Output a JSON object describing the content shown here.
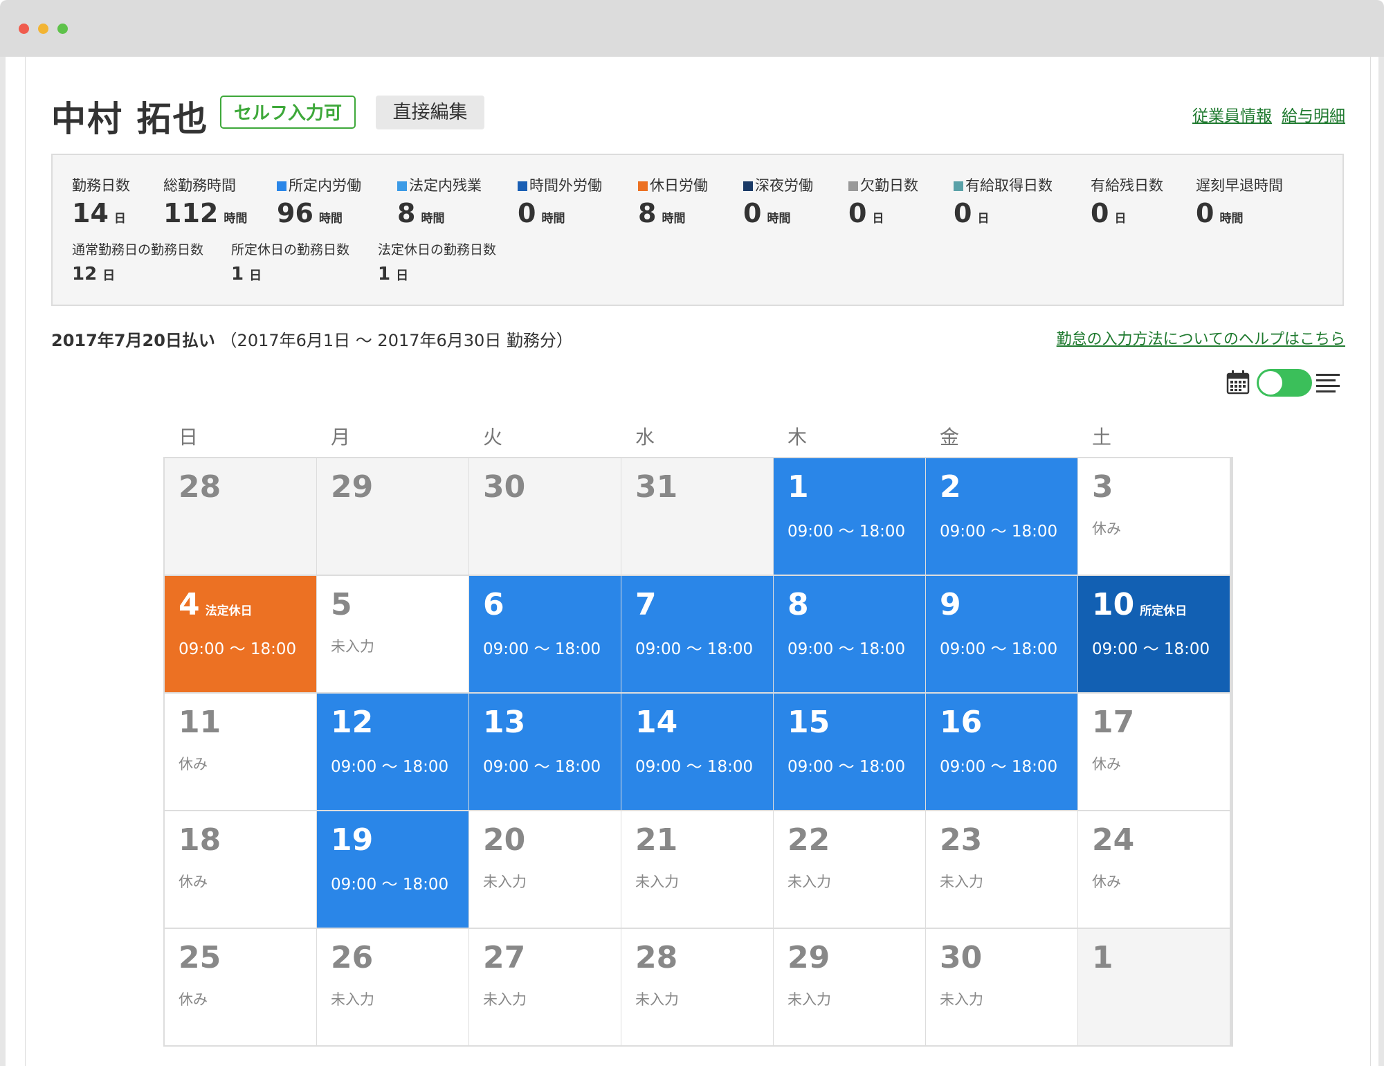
{
  "employee": {
    "name": "中村 拓也",
    "badge": "セルフ入力可",
    "edit_label": "直接編集",
    "links": [
      "従業員情報",
      "給与明細"
    ]
  },
  "summary": {
    "primary": [
      {
        "label": "勤務日数",
        "value": "14",
        "unit": "日",
        "color": ""
      },
      {
        "label": "総勤務時間",
        "value": "112",
        "unit": "時間",
        "color": ""
      },
      {
        "label": "所定内労働",
        "value": "96",
        "unit": "時間",
        "color": "#2a86e8"
      },
      {
        "label": "法定内残業",
        "value": "8",
        "unit": "時間",
        "color": "#3c9be6"
      },
      {
        "label": "時間外労働",
        "value": "0",
        "unit": "時間",
        "color": "#1a5fb4"
      },
      {
        "label": "休日労働",
        "value": "8",
        "unit": "時間",
        "color": "#ec7123"
      },
      {
        "label": "深夜労働",
        "value": "0",
        "unit": "時間",
        "color": "#1a3a66"
      },
      {
        "label": "欠勤日数",
        "value": "0",
        "unit": "日",
        "color": "#999999"
      },
      {
        "label": "有給取得日数",
        "value": "0",
        "unit": "日",
        "color": "#5aa1a8"
      },
      {
        "label": "有給残日数",
        "value": "0",
        "unit": "日",
        "color": ""
      },
      {
        "label": "遅刻早退時間",
        "value": "0",
        "unit": "時間",
        "color": ""
      }
    ],
    "secondary": [
      {
        "label": "通常勤務日の勤務日数",
        "value": "12",
        "unit": "日"
      },
      {
        "label": "所定休日の勤務日数",
        "value": "1",
        "unit": "日"
      },
      {
        "label": "法定休日の勤務日数",
        "value": "1",
        "unit": "日"
      }
    ]
  },
  "period": {
    "payday": "2017年7月20日払い",
    "range": "（2017年6月1日 〜 2017年6月30日 勤務分）",
    "help": "勤怠の入力方法についてのヘルプはこちら"
  },
  "view": {
    "calendar_icon": "calendar-icon",
    "list_icon": "list-icon",
    "toggle_on": true
  },
  "calendar": {
    "weekdays": [
      "日",
      "月",
      "火",
      "水",
      "木",
      "金",
      "土"
    ],
    "days": [
      {
        "day": "28",
        "type": "other",
        "tag": "",
        "text": ""
      },
      {
        "day": "29",
        "type": "other",
        "tag": "",
        "text": ""
      },
      {
        "day": "30",
        "type": "other",
        "tag": "",
        "text": ""
      },
      {
        "day": "31",
        "type": "other",
        "tag": "",
        "text": ""
      },
      {
        "day": "1",
        "type": "work",
        "tag": "",
        "text": "09:00 〜 18:00"
      },
      {
        "day": "2",
        "type": "work",
        "tag": "",
        "text": "09:00 〜 18:00"
      },
      {
        "day": "3",
        "type": "rest",
        "tag": "",
        "text": "休み"
      },
      {
        "day": "4",
        "type": "holiday",
        "tag": "法定休日",
        "text": "09:00 〜 18:00"
      },
      {
        "day": "5",
        "type": "empty",
        "tag": "",
        "text": "未入力"
      },
      {
        "day": "6",
        "type": "work",
        "tag": "",
        "text": "09:00 〜 18:00"
      },
      {
        "day": "7",
        "type": "work",
        "tag": "",
        "text": "09:00 〜 18:00"
      },
      {
        "day": "8",
        "type": "work",
        "tag": "",
        "text": "09:00 〜 18:00"
      },
      {
        "day": "9",
        "type": "work",
        "tag": "",
        "text": "09:00 〜 18:00"
      },
      {
        "day": "10",
        "type": "special",
        "tag": "所定休日",
        "text": "09:00 〜 18:00"
      },
      {
        "day": "11",
        "type": "rest",
        "tag": "",
        "text": "休み"
      },
      {
        "day": "12",
        "type": "work",
        "tag": "",
        "text": "09:00 〜 18:00"
      },
      {
        "day": "13",
        "type": "work",
        "tag": "",
        "text": "09:00 〜 18:00"
      },
      {
        "day": "14",
        "type": "work",
        "tag": "",
        "text": "09:00 〜 18:00"
      },
      {
        "day": "15",
        "type": "work",
        "tag": "",
        "text": "09:00 〜 18:00"
      },
      {
        "day": "16",
        "type": "work",
        "tag": "",
        "text": "09:00 〜 18:00"
      },
      {
        "day": "17",
        "type": "rest",
        "tag": "",
        "text": "休み"
      },
      {
        "day": "18",
        "type": "rest",
        "tag": "",
        "text": "休み"
      },
      {
        "day": "19",
        "type": "work",
        "tag": "",
        "text": "09:00 〜 18:00"
      },
      {
        "day": "20",
        "type": "empty",
        "tag": "",
        "text": "未入力"
      },
      {
        "day": "21",
        "type": "empty",
        "tag": "",
        "text": "未入力"
      },
      {
        "day": "22",
        "type": "empty",
        "tag": "",
        "text": "未入力"
      },
      {
        "day": "23",
        "type": "empty",
        "tag": "",
        "text": "未入力"
      },
      {
        "day": "24",
        "type": "rest",
        "tag": "",
        "text": "休み"
      },
      {
        "day": "25",
        "type": "rest",
        "tag": "",
        "text": "休み"
      },
      {
        "day": "26",
        "type": "empty",
        "tag": "",
        "text": "未入力"
      },
      {
        "day": "27",
        "type": "empty",
        "tag": "",
        "text": "未入力"
      },
      {
        "day": "28",
        "type": "empty",
        "tag": "",
        "text": "未入力"
      },
      {
        "day": "29",
        "type": "empty",
        "tag": "",
        "text": "未入力"
      },
      {
        "day": "30",
        "type": "empty",
        "tag": "",
        "text": "未入力"
      },
      {
        "day": "1",
        "type": "other",
        "tag": "",
        "text": ""
      }
    ]
  }
}
